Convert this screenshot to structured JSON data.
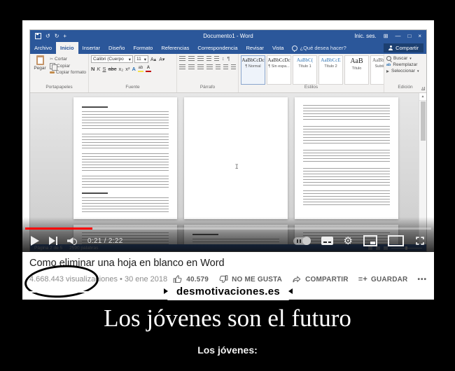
{
  "colors": {
    "word_blue": "#2b579a",
    "share_blue": "#1c3f70",
    "youtube_red": "#ff0000"
  },
  "titlebar": {
    "title": "Documento1 - Word",
    "signin": "Inic. ses.",
    "minimize": "—",
    "maximize": "□",
    "close": "×"
  },
  "tabs": {
    "items": [
      "Archivo",
      "Inicio",
      "Insertar",
      "Diseño",
      "Formato",
      "Referencias",
      "Correspondencia",
      "Revisar",
      "Vista"
    ],
    "active": "Inicio",
    "tellme": "¿Qué desea hacer?",
    "share": "Compartir"
  },
  "ribbon": {
    "groups": [
      "Portapapeles",
      "Fuente",
      "Párrafo",
      "Estilos",
      "Edición"
    ],
    "paste": "Pegar",
    "cut": "Cortar",
    "copy": "Copiar",
    "format_painter": "Copiar formato",
    "font_name": "Calibri (Cuerpo",
    "font_size": "11",
    "bold": "N",
    "italic": "K",
    "underline": "S",
    "strike": "abc",
    "subscript": "x₂",
    "superscript": "x²",
    "grow_font": "A▴",
    "shrink_font": "A▾",
    "change_case": "Aa▾",
    "text_effects": "A",
    "font_color": "A",
    "pilcrow": "¶",
    "sort": "↕",
    "styles": [
      {
        "sample": "AaBbCcDc",
        "label": "¶ Normal",
        "color": "#1f1f1f"
      },
      {
        "sample": "AaBbCcDc",
        "label": "¶ Sin espa...",
        "color": "#1f1f1f"
      },
      {
        "sample": "AaBbC(",
        "label": "Título 1",
        "color": "#2e74b5"
      },
      {
        "sample": "AaBbCcE",
        "label": "Título 2",
        "color": "#2e74b5"
      },
      {
        "sample": "AaB",
        "label": "Título",
        "color": "#1f1f1f"
      },
      {
        "sample": "AaBbCcC",
        "label": "Subtítulo",
        "color": "#5a5a5a"
      }
    ],
    "editing": [
      "Buscar",
      "Reemplazar",
      "Seleccionar"
    ]
  },
  "statusbar": {
    "page": "Página 2 de 5",
    "words": "2590 palabras"
  },
  "player": {
    "time": "0:21 / 2:22"
  },
  "video": {
    "title": "Como eliminar una hoja en blanco en Word",
    "views": "4.668.443",
    "views_rest": "visualizaciones • 30 ene 2018",
    "likes": "40.579",
    "dislike": "NO ME GUSTA",
    "share": "COMPARTIR",
    "save": "GUARDAR",
    "save_glyph": "≡+",
    "more": "•••"
  },
  "watermark": "desmotivaciones.es",
  "caption": {
    "title": "Los jóvenes son el futuro",
    "subtitle": "Los jóvenes:"
  }
}
